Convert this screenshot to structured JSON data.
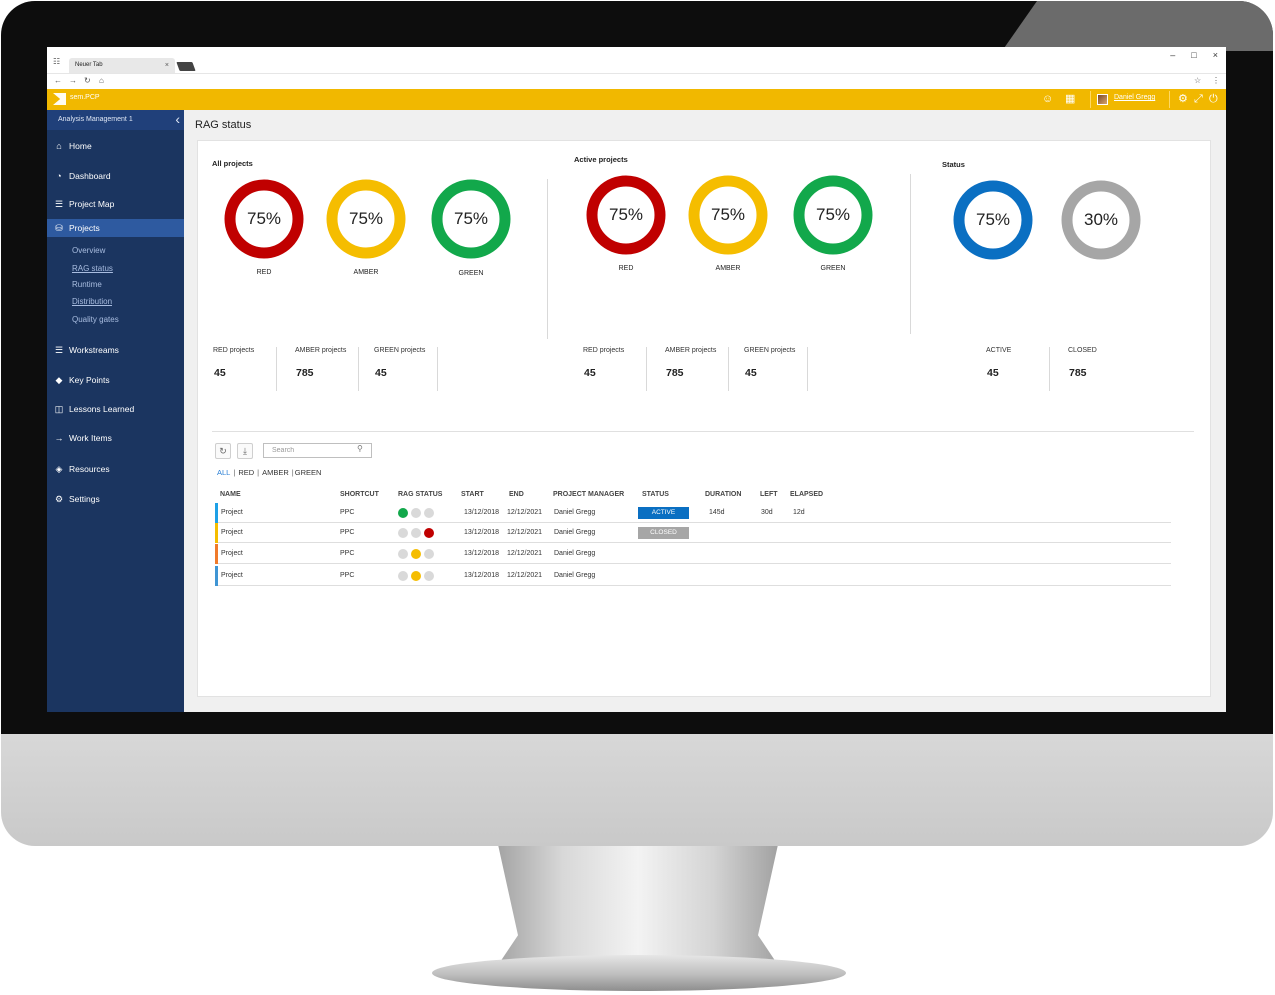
{
  "browser": {
    "tab_title": "Neuer Tab",
    "tab_close": "×",
    "address_value": "",
    "window_buttons": {
      "minimize": "–",
      "maximize": "□",
      "close": "×"
    }
  },
  "app": {
    "name": "sem.PCP",
    "user": "Daniel Gregg",
    "accent_color": "#f1b800",
    "sidebar_color": "#1b3560"
  },
  "sidebar": {
    "header": "Analysis Management 1",
    "items": [
      {
        "label": "Home",
        "icon": "home-icon"
      },
      {
        "label": "Dashboard",
        "icon": "gauge-icon"
      },
      {
        "label": "Project Map",
        "icon": "map-icon"
      },
      {
        "label": "Projects",
        "icon": "database-icon",
        "active": true
      },
      {
        "label": "Workstreams",
        "icon": "list-icon"
      },
      {
        "label": "Key Points",
        "icon": "diamond-icon"
      },
      {
        "label": "Lessons Learned",
        "icon": "presentation-icon"
      },
      {
        "label": "Work Items",
        "icon": "wrench-icon"
      },
      {
        "label": "Resources",
        "icon": "layers-icon"
      },
      {
        "label": "Settings",
        "icon": "gear-icon"
      }
    ],
    "subitems": [
      "Overview",
      "RAG status",
      "Runtime",
      "Distribution",
      "Quality gates"
    ]
  },
  "page": {
    "title": "RAG status"
  },
  "groups": {
    "all": {
      "title": "All projects",
      "donuts": [
        {
          "value": "75%",
          "fraction": 1.0,
          "label": "RED",
          "color": "#c00000"
        },
        {
          "value": "75%",
          "fraction": 1.0,
          "label": "AMBER",
          "color": "#f5bd00"
        },
        {
          "value": "75%",
          "fraction": 1.0,
          "label": "GREEN",
          "color": "#12a84b"
        }
      ],
      "stats": [
        {
          "label": "RED projects",
          "value": "45"
        },
        {
          "label": "AMBER projects",
          "value": "785"
        },
        {
          "label": "GREEN projects",
          "value": "45"
        }
      ]
    },
    "active": {
      "title": "Active projects",
      "donuts": [
        {
          "value": "75%",
          "fraction": 1.0,
          "label": "RED",
          "color": "#c00000"
        },
        {
          "value": "75%",
          "fraction": 1.0,
          "label": "AMBER",
          "color": "#f5bd00"
        },
        {
          "value": "75%",
          "fraction": 1.0,
          "label": "GREEN",
          "color": "#12a84b"
        }
      ],
      "stats": [
        {
          "label": "RED projects",
          "value": "45"
        },
        {
          "label": "AMBER projects",
          "value": "785"
        },
        {
          "label": "GREEN projects",
          "value": "45"
        }
      ]
    },
    "status": {
      "title": "Status",
      "donuts": [
        {
          "value": "75%",
          "fraction": 1.0,
          "color": "#0a6fc2"
        },
        {
          "value": "30%",
          "fraction": 1.0,
          "color": "#a6a6a6"
        }
      ],
      "stats": [
        {
          "label": "ACTIVE",
          "value": "45"
        },
        {
          "label": "CLOSED",
          "value": "785"
        }
      ]
    }
  },
  "table": {
    "search_placeholder": "Search",
    "filters": {
      "all": "ALL",
      "red": "RED",
      "amber": "AMBER",
      "green": "GREEN"
    },
    "headers": {
      "name": "NAME",
      "shortcut": "SHORTCUT",
      "rag": "RAG STATUS",
      "start": "START",
      "end": "END",
      "pm": "PROJECT MANAGER",
      "status": "STATUS",
      "duration": "DURATION",
      "left": "LEFT",
      "elapsed": "ELAPSED"
    },
    "rows": [
      {
        "bar": "#1ea0e6",
        "name": "Project",
        "shortcut": "PPC",
        "rag": [
          "#12a84b",
          "#d9d9d9",
          "#d9d9d9"
        ],
        "start": "13/12/2018",
        "end": "12/12/2021",
        "pm": "Daniel Gregg",
        "status": "ACTIVE",
        "status_color": "#0a6fc2",
        "duration": "145d",
        "left": "30d",
        "elapsed": "12d"
      },
      {
        "bar": "#f5bd00",
        "name": "Project",
        "shortcut": "PPC",
        "rag": [
          "#d9d9d9",
          "#d9d9d9",
          "#c00000"
        ],
        "start": "13/12/2018",
        "end": "12/12/2021",
        "pm": "Daniel Gregg",
        "status": "CLOSED",
        "status_color": "#a6a6a6",
        "duration": "",
        "left": "",
        "elapsed": ""
      },
      {
        "bar": "#f07a2a",
        "name": "Project",
        "shortcut": "PPC",
        "rag": [
          "#d9d9d9",
          "#f5bd00",
          "#d9d9d9"
        ],
        "start": "13/12/2018",
        "end": "12/12/2021",
        "pm": "Daniel Gregg",
        "status": "",
        "status_color": "",
        "duration": "",
        "left": "",
        "elapsed": ""
      },
      {
        "bar": "#3f95d4",
        "name": "Project",
        "shortcut": "PPC",
        "rag": [
          "#d9d9d9",
          "#f5bd00",
          "#d9d9d9"
        ],
        "start": "13/12/2018",
        "end": "12/12/2021",
        "pm": "Daniel Gregg",
        "status": "",
        "status_color": "",
        "duration": "",
        "left": "",
        "elapsed": ""
      }
    ]
  }
}
